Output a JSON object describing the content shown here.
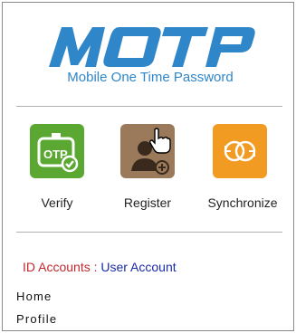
{
  "brand": {
    "logo_text": "MOTP",
    "subtitle": "Mobile One Time Password"
  },
  "actions": [
    {
      "label": "Verify",
      "icon": "otp-check-icon",
      "color": "#5aa832"
    },
    {
      "label": "Register",
      "icon": "add-user-icon",
      "color": "#9a7a5a"
    },
    {
      "label": "Synchronize",
      "icon": "sync-icon",
      "color": "#f19b22"
    }
  ],
  "account": {
    "label": "ID Accounts",
    "separator": ":",
    "value": "User Account"
  },
  "menu": [
    {
      "label": "Home"
    },
    {
      "label": "Profile"
    }
  ],
  "colors": {
    "brand_blue": "#2f86c8",
    "account_label": "#c0282d",
    "account_value": "#1a2aa8"
  }
}
